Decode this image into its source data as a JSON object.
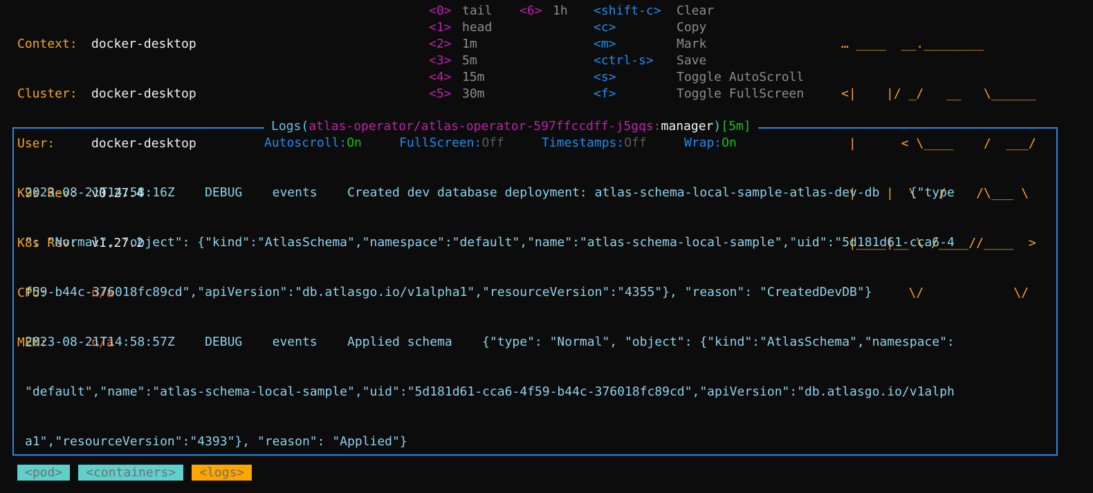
{
  "info": [
    {
      "label": "Context:",
      "value": "docker-desktop",
      "tone": "white"
    },
    {
      "label": "Cluster:",
      "value": "docker-desktop",
      "tone": "white"
    },
    {
      "label": "User:",
      "value": "docker-desktop",
      "tone": "white"
    },
    {
      "label": "K9s Rev:",
      "value": "v0.27.4",
      "tone": "white"
    },
    {
      "label": "K8s Rev:",
      "value": "v1.27.2",
      "tone": "white"
    },
    {
      "label": "CPU:",
      "value": "n/a",
      "tone": "red"
    },
    {
      "label": "MEM:",
      "value": "n/a",
      "tone": "red"
    }
  ],
  "time_keys": [
    {
      "key": "<0>",
      "action": "tail"
    },
    {
      "key": "<1>",
      "action": "head"
    },
    {
      "key": "<2>",
      "action": "1m"
    },
    {
      "key": "<3>",
      "action": "5m"
    },
    {
      "key": "<4>",
      "action": "15m"
    },
    {
      "key": "<5>",
      "action": "30m"
    }
  ],
  "time_keys_2": [
    {
      "key": "<6>",
      "action": "1h"
    }
  ],
  "action_keys": [
    {
      "key": "<shift-c>",
      "action": "Clear"
    },
    {
      "key": "<c>",
      "action": "Copy"
    },
    {
      "key": "<m>",
      "action": "Mark"
    },
    {
      "key": "<ctrl-s>",
      "action": "Save"
    },
    {
      "key": "<s>",
      "action": "Toggle AutoScroll"
    },
    {
      "key": "<f>",
      "action": "Toggle FullScreen"
    }
  ],
  "logo": [
    "… ____  __.________",
    "<|    |/ _/   __   \\______",
    " |      < \\____    /  ___/",
    " |    |  \\   /    /\\___ \\",
    " |____|__ \\ /____//____  >",
    "         \\/            \\/"
  ],
  "pane": {
    "title_prefix": "Logs(",
    "title_path": "atlas-operator/atlas-operator-597ffccdff-j5gqs:",
    "title_container": "manager",
    "title_close": ")",
    "title_range": "[5m]"
  },
  "status": {
    "autoscroll_label": "Autoscroll:",
    "autoscroll_value": "On",
    "fullscreen_label": "FullScreen:",
    "fullscreen_value": "Off",
    "timestamps_label": "Timestamps:",
    "timestamps_value": "Off",
    "wrap_label": "Wrap:",
    "wrap_value": "On"
  },
  "log_lines": [
    "2023-08-21T14:58:16Z    DEBUG    events    Created dev database deployment: atlas-schema-local-sample-atlas-dev-db    {\"type",
    "\": \"Normal\", \"object\": {\"kind\":\"AtlasSchema\",\"namespace\":\"default\",\"name\":\"atlas-schema-local-sample\",\"uid\":\"5d181d61-cca6-4",
    "f59-b44c-376018fc89cd\",\"apiVersion\":\"db.atlasgo.io/v1alpha1\",\"resourceVersion\":\"4355\"}, \"reason\": \"CreatedDevDB\"}",
    "2023-08-21T14:58:57Z    DEBUG    events    Applied schema    {\"type\": \"Normal\", \"object\": {\"kind\":\"AtlasSchema\",\"namespace\":",
    "\"default\",\"name\":\"atlas-schema-local-sample\",\"uid\":\"5d181d61-cca6-4f59-b44c-376018fc89cd\",\"apiVersion\":\"db.atlasgo.io/v1alph",
    "a1\",\"resourceVersion\":\"4393\"}, \"reason\": \"Applied\"}"
  ],
  "crumbs": [
    {
      "label": "<pod>",
      "tone": "cyan"
    },
    {
      "label": "<containers>",
      "tone": "cyan"
    },
    {
      "label": "<logs>",
      "tone": "orange"
    }
  ]
}
